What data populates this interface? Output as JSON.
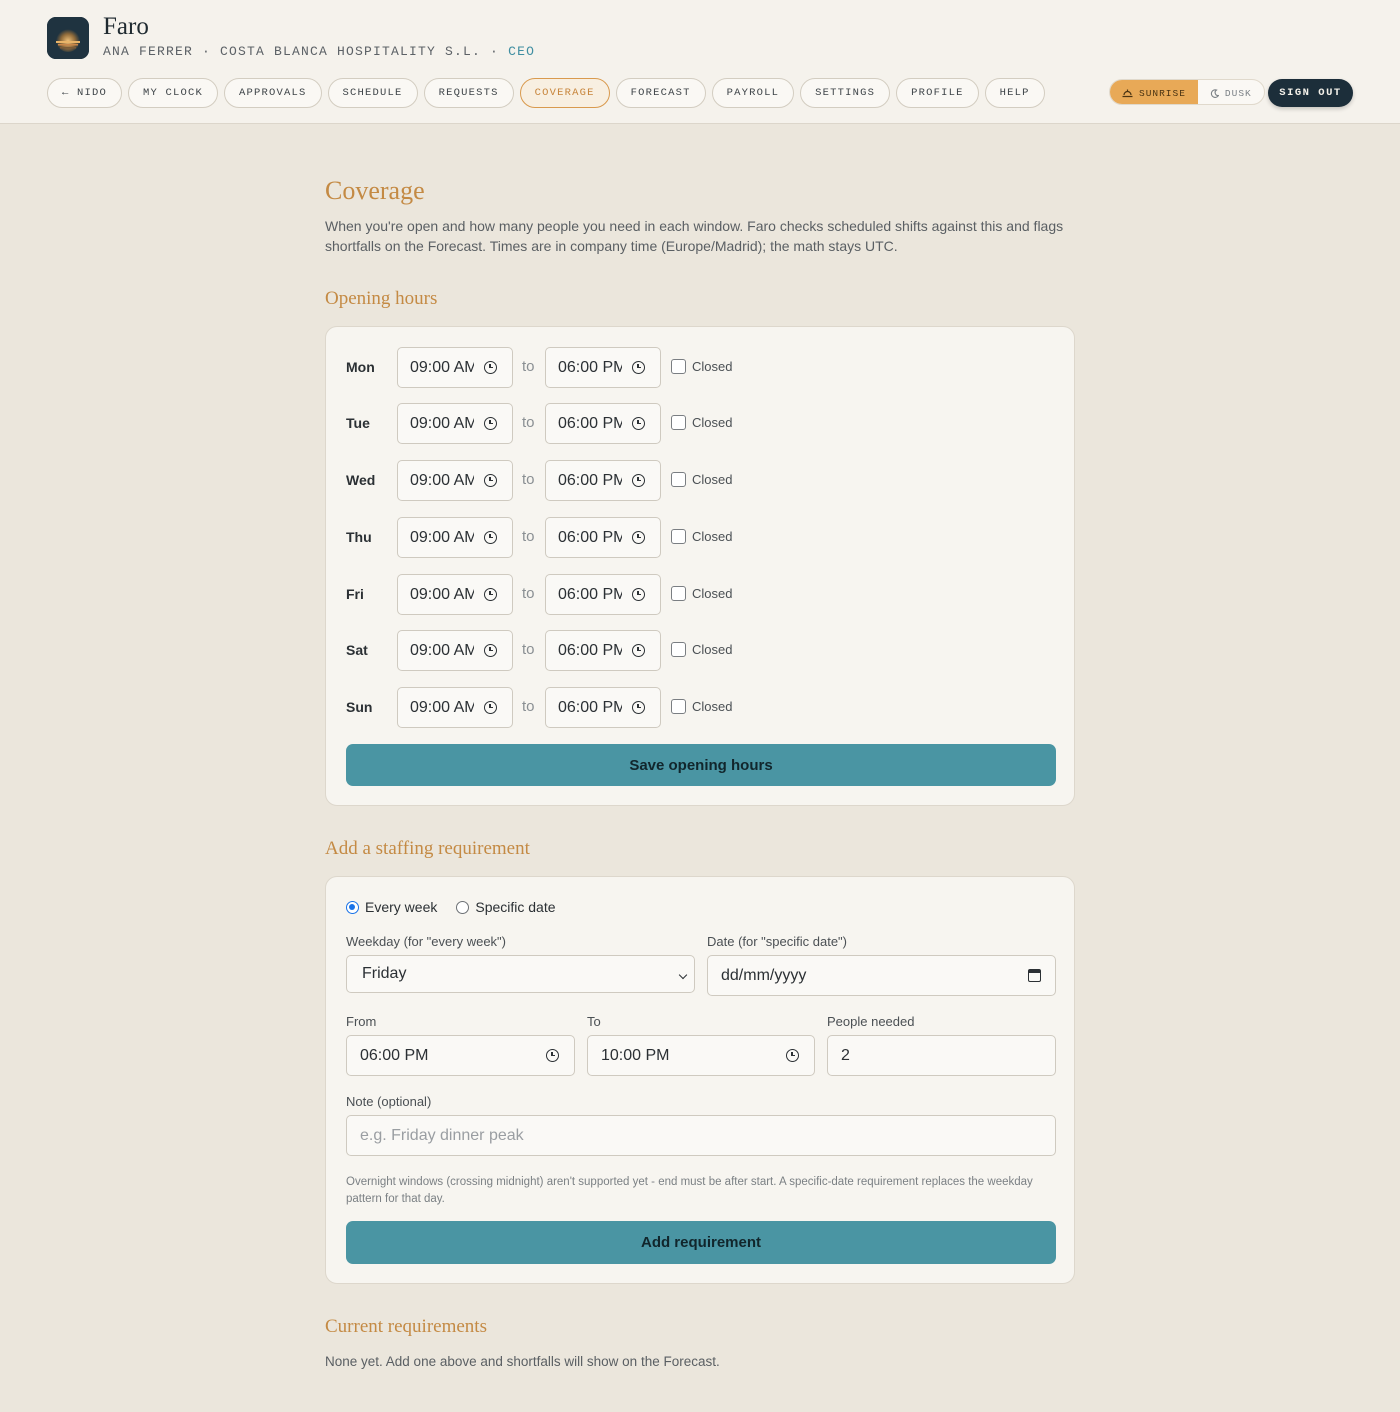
{
  "app": {
    "title": "Faro",
    "user_line": "ANA FERRER · COSTA BLANCA HOSPITALITY S.L. · ",
    "role": "CEO"
  },
  "nav": [
    {
      "label": "← NIDO",
      "active": false
    },
    {
      "label": "MY CLOCK",
      "active": false
    },
    {
      "label": "APPROVALS",
      "active": false
    },
    {
      "label": "SCHEDULE",
      "active": false
    },
    {
      "label": "REQUESTS",
      "active": false
    },
    {
      "label": "COVERAGE",
      "active": true
    },
    {
      "label": "FORECAST",
      "active": false
    },
    {
      "label": "PAYROLL",
      "active": false
    },
    {
      "label": "SETTINGS",
      "active": false
    },
    {
      "label": "PROFILE",
      "active": false
    },
    {
      "label": "HELP",
      "active": false
    }
  ],
  "theme": {
    "sunrise": "SUNRISE",
    "dusk": "DUSK",
    "selected": "sunrise"
  },
  "sign_out": "SIGN OUT",
  "page": {
    "title": "Coverage",
    "intro": "When you're open and how many people you need in each window. Faro checks scheduled shifts against this and flags shortfalls on the Forecast. Times are in company time (Europe/Madrid); the math stays UTC."
  },
  "opening_hours": {
    "heading": "Opening hours",
    "to_label": "to",
    "closed_label": "Closed",
    "days": [
      {
        "day": "Mon",
        "open": "09:00 AM",
        "close": "06:00 PM",
        "closed": false
      },
      {
        "day": "Tue",
        "open": "09:00 AM",
        "close": "06:00 PM",
        "closed": false
      },
      {
        "day": "Wed",
        "open": "09:00 AM",
        "close": "06:00 PM",
        "closed": false
      },
      {
        "day": "Thu",
        "open": "09:00 AM",
        "close": "06:00 PM",
        "closed": false
      },
      {
        "day": "Fri",
        "open": "09:00 AM",
        "close": "06:00 PM",
        "closed": false
      },
      {
        "day": "Sat",
        "open": "09:00 AM",
        "close": "06:00 PM",
        "closed": false
      },
      {
        "day": "Sun",
        "open": "09:00 AM",
        "close": "06:00 PM",
        "closed": false
      }
    ],
    "save_label": "Save opening hours"
  },
  "requirement_form": {
    "heading": "Add a staffing requirement",
    "mode_every_week": "Every week",
    "mode_specific_date": "Specific date",
    "selected_mode": "every_week",
    "weekday_label": "Weekday (for \"every week\")",
    "weekday_value": "Friday",
    "date_label": "Date (for \"specific date\")",
    "date_placeholder": "dd/mm/yyyy",
    "from_label": "From",
    "from_value": "06:00 PM",
    "to_label": "To",
    "to_value": "10:00 PM",
    "people_label": "People needed",
    "people_value": "2",
    "note_label": "Note (optional)",
    "note_placeholder": "e.g. Friday dinner peak",
    "help": "Overnight windows (crossing midnight) aren't supported yet - end must be after start. A specific-date requirement replaces the weekday pattern for that day.",
    "submit_label": "Add requirement"
  },
  "current": {
    "heading": "Current requirements",
    "empty_text": "None yet. Add one above and shortfalls will show on the Forecast."
  }
}
